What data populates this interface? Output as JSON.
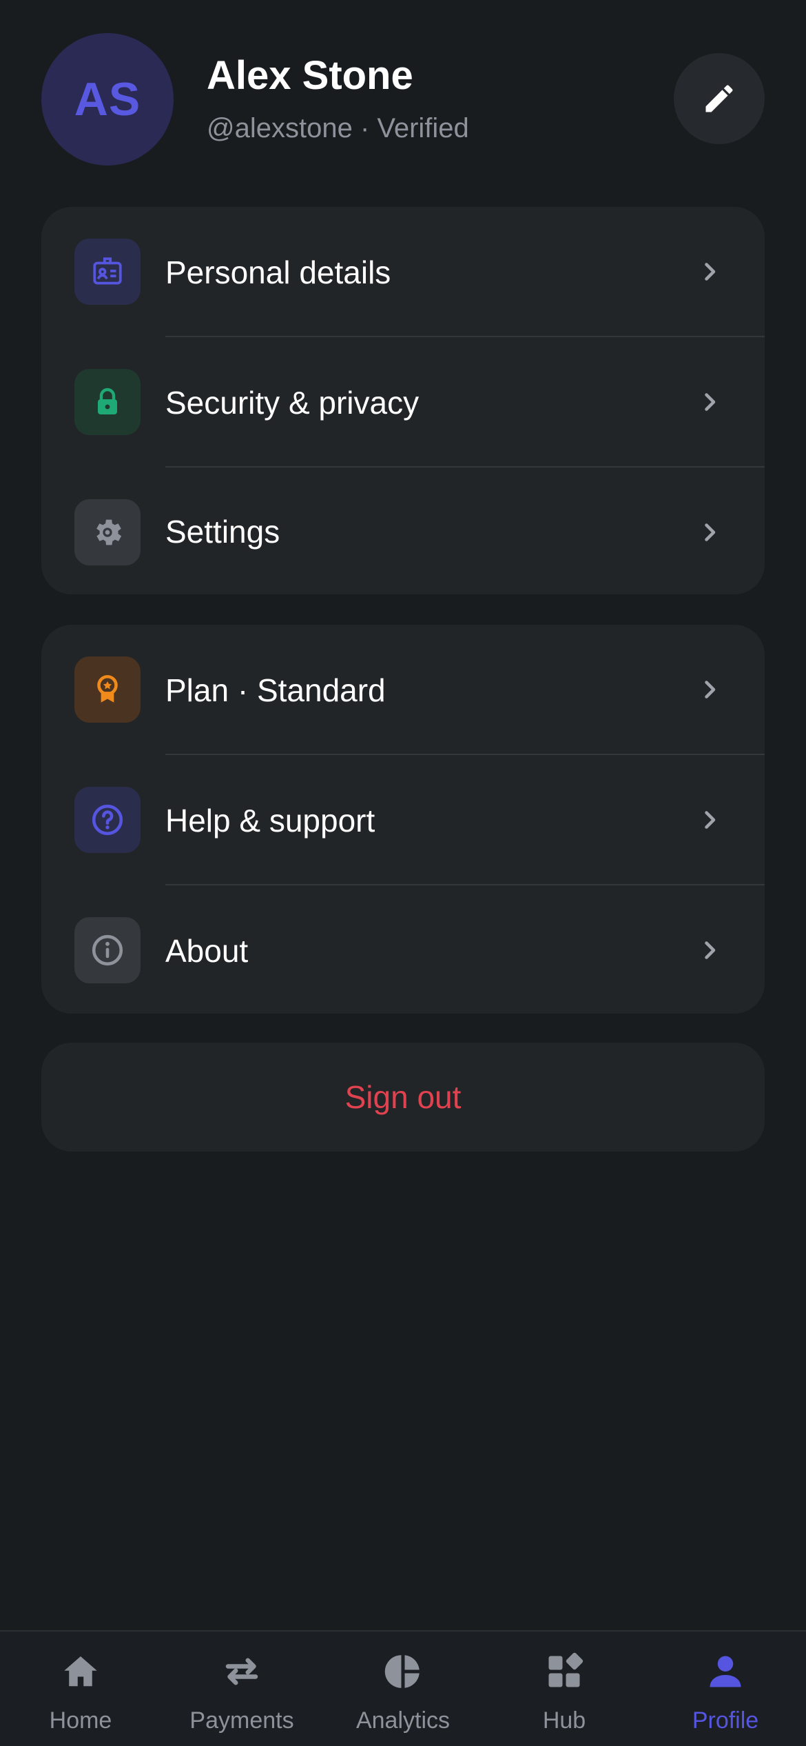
{
  "profile": {
    "initials": "AS",
    "name": "Alex Stone",
    "handle": "@alexstone · Verified"
  },
  "icons": {
    "edit": "pencil-icon",
    "chevron": "chevron-right-icon"
  },
  "colors": {
    "background": "#191c1f",
    "card": "#222528",
    "accent": "#5555e0",
    "danger": "#e0434f",
    "muted": "#8e939b"
  },
  "menu_group_1": [
    {
      "label": "Personal details",
      "icon": "id-card-icon",
      "icon_color": "#5555e0",
      "icon_bg": "#2b2d4d"
    },
    {
      "label": "Security & privacy",
      "icon": "lock-icon",
      "icon_color": "#1faa75",
      "icon_bg": "#20392f"
    },
    {
      "label": "Settings",
      "icon": "gear-icon",
      "icon_color": "#8e939b",
      "icon_bg": "#35383c"
    }
  ],
  "menu_group_2": [
    {
      "label": "Plan · Standard",
      "icon": "award-ribbon-icon",
      "icon_color": "#f08a1a",
      "icon_bg": "#4a3320"
    },
    {
      "label": "Help & support",
      "icon": "help-circle-icon",
      "icon_color": "#5555e0",
      "icon_bg": "#2b2d4d"
    },
    {
      "label": "About",
      "icon": "info-circle-icon",
      "icon_color": "#8e939b",
      "icon_bg": "#35383c"
    }
  ],
  "sign_out_label": "Sign out",
  "tabs": [
    {
      "label": "Home",
      "icon": "home-icon",
      "active": false
    },
    {
      "label": "Payments",
      "icon": "transfer-arrows-icon",
      "active": false
    },
    {
      "label": "Analytics",
      "icon": "pie-chart-icon",
      "active": false
    },
    {
      "label": "Hub",
      "icon": "widgets-icon",
      "active": false
    },
    {
      "label": "Profile",
      "icon": "user-icon",
      "active": true
    }
  ]
}
